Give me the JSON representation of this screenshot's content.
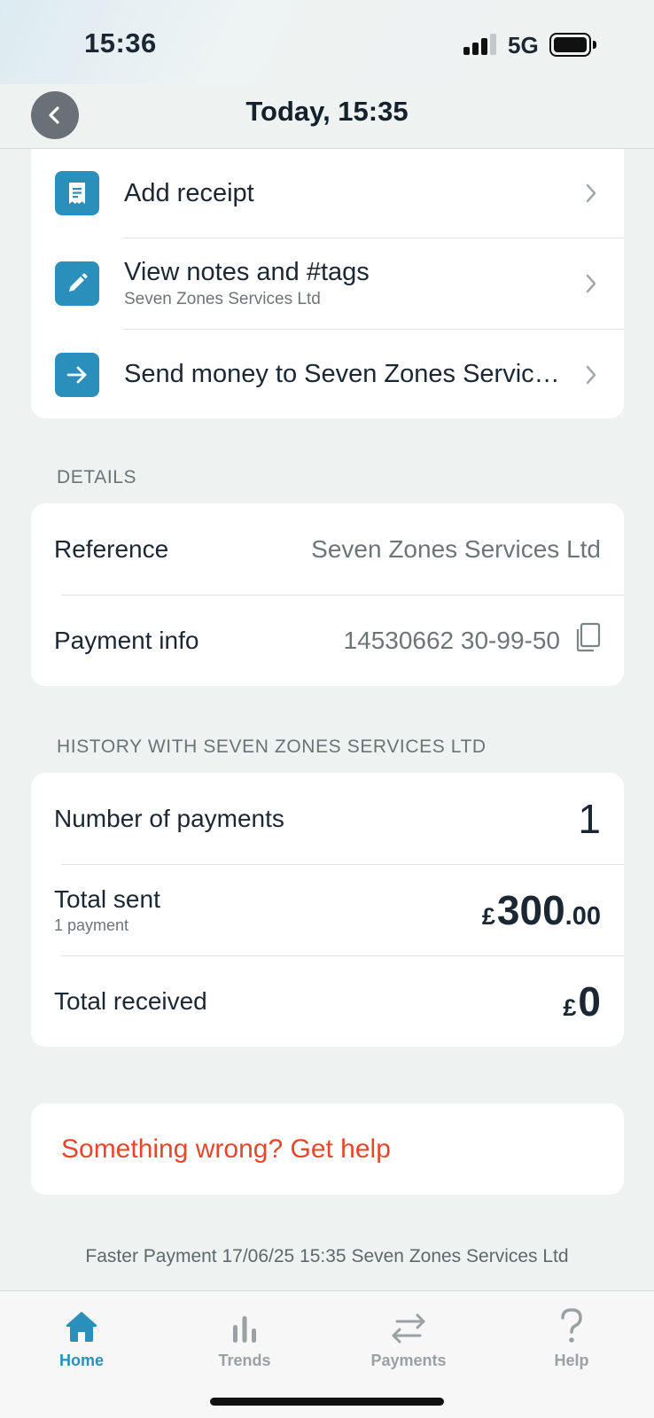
{
  "status_bar": {
    "time": "15:36",
    "network": "5G"
  },
  "header": {
    "title": "Today, 15:35"
  },
  "actions": [
    {
      "label": "Add receipt",
      "sublabel": "",
      "icon": "receipt-icon"
    },
    {
      "label": "View notes and #tags",
      "sublabel": "Seven Zones Services Ltd",
      "icon": "pencil-icon"
    },
    {
      "label": "Send money to Seven Zones Services Ltd",
      "sublabel": "",
      "icon": "arrow-right-icon"
    }
  ],
  "details": {
    "heading": "DETAILS",
    "reference_label": "Reference",
    "reference_value": "Seven Zones Services Ltd",
    "payment_info_label": "Payment info",
    "payment_info_value": "14530662 30-99-50"
  },
  "history": {
    "heading": "HISTORY WITH SEVEN ZONES SERVICES LTD",
    "num_payments_label": "Number of payments",
    "num_payments_value": "1",
    "total_sent_label": "Total sent",
    "total_sent_sub": "1 payment",
    "total_sent_currency": "£",
    "total_sent_main": "300",
    "total_sent_decimal": ".00",
    "total_received_label": "Total received",
    "total_received_currency": "£",
    "total_received_main": "0"
  },
  "help": {
    "label": "Something wrong? Get help"
  },
  "footer": {
    "meta": "Faster Payment 17/06/25 15:35 Seven Zones Services Ltd"
  },
  "tabs": [
    {
      "label": "Home",
      "active": true,
      "icon": "home-icon"
    },
    {
      "label": "Trends",
      "active": false,
      "icon": "bar-chart-icon"
    },
    {
      "label": "Payments",
      "active": false,
      "icon": "transfer-arrows-icon"
    },
    {
      "label": "Help",
      "active": false,
      "icon": "question-mark-icon"
    }
  ],
  "colors": {
    "accent": "#2a8fba",
    "danger": "#e5472c",
    "background": "#eef2f0"
  }
}
